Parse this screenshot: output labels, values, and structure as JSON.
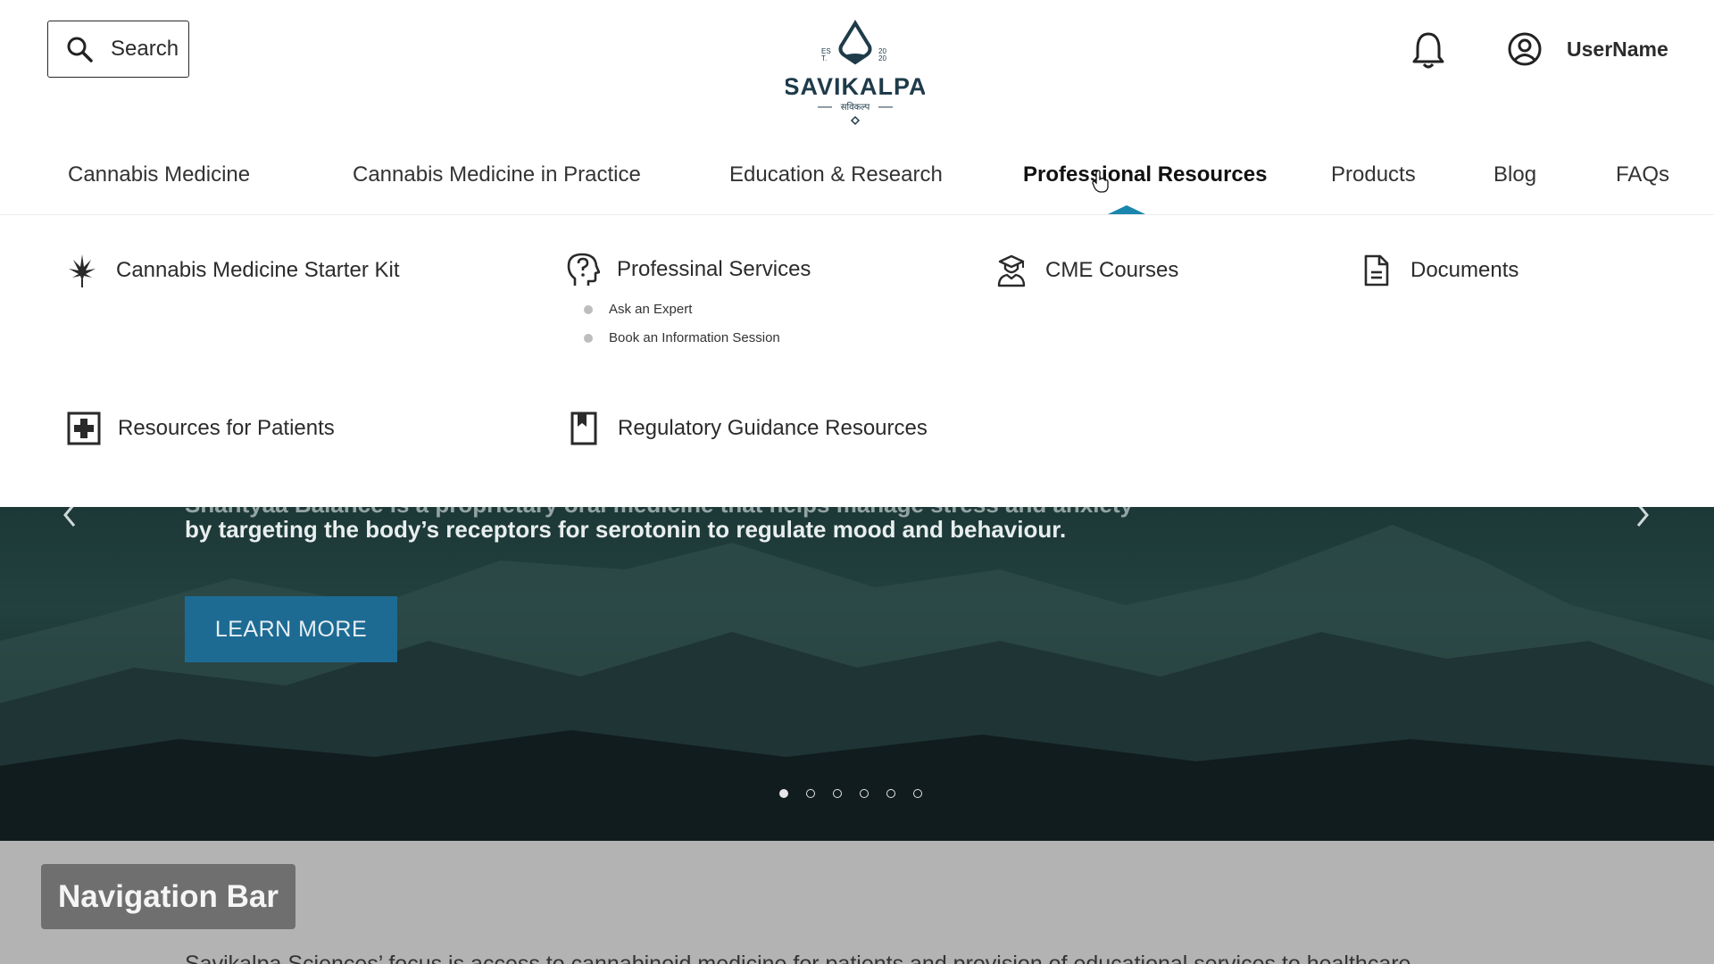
{
  "search": {
    "label": "Search"
  },
  "logo": {
    "brand": "SAVIKALPA",
    "tagline": "सविकल्प",
    "est_left": "ES T.",
    "est_right": "20 20"
  },
  "user": {
    "name": "UserName"
  },
  "nav": {
    "items": [
      {
        "label": "Cannabis Medicine"
      },
      {
        "label": "Cannabis Medicine in Practice"
      },
      {
        "label": "Education & Research"
      },
      {
        "label": "Professional Resources"
      },
      {
        "label": "Products"
      },
      {
        "label": "Blog"
      },
      {
        "label": "FAQs"
      }
    ],
    "active": "Professional Resources"
  },
  "dropdown": {
    "items": [
      {
        "label": "Cannabis Medicine Starter Kit",
        "icon": "cannabis-leaf-icon"
      },
      {
        "label": "Professinal Services",
        "icon": "head-question-icon",
        "sub_items": [
          {
            "label": "Ask an Expert"
          },
          {
            "label": "Book an Information Session"
          }
        ]
      },
      {
        "label": "CME Courses",
        "icon": "graduate-icon"
      },
      {
        "label": "Documents",
        "icon": "document-icon"
      },
      {
        "label": "Resources for Patients",
        "icon": "medical-plus-icon"
      },
      {
        "label": "Regulatory Guidance Resources",
        "icon": "bookmark-book-icon"
      }
    ]
  },
  "hero": {
    "text_cut": "Shantyaa Balance is a proprietary oral medicine that helps manage stress and anxiety",
    "text": "by targeting the body’s receptors for serotonin to regulate mood and behaviour.",
    "button": "LEARN MORE",
    "active_slide": 1
  },
  "annotation": {
    "label": "Navigation Bar",
    "body": "Savikalpa Sciences’ focus is access to cannabinoid medicine for patients and provision of educational services to healthcare"
  },
  "colors": {
    "accent": "#1a86ad",
    "button": "#1d6b93",
    "logo": "#1f3b4a"
  }
}
